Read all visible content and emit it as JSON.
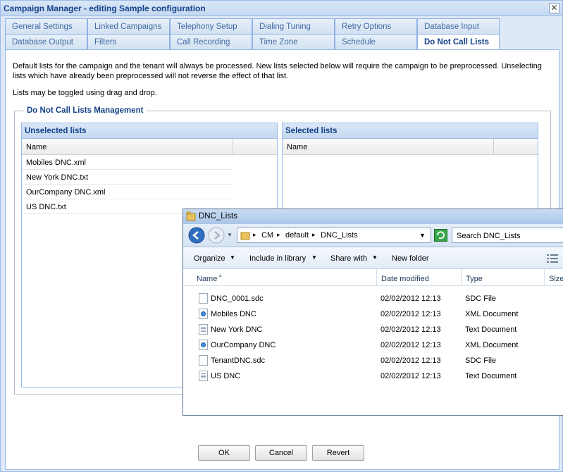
{
  "window": {
    "title": "Campaign Manager - editing Sample configuration",
    "close_glyph": "✕"
  },
  "tabs": {
    "row1": [
      "General Settings",
      "Linked Campaigns",
      "Telephony Setup",
      "Dialing Tuning",
      "Retry Options",
      "Database Input"
    ],
    "row2": [
      "Database Output",
      "Filters",
      "Call Recording",
      "Time Zone",
      "Schedule",
      "Do Not Call Lists"
    ],
    "active": "Do Not Call Lists"
  },
  "content": {
    "description": "Default lists for the campaign and the tenant will always be processed. New lists selected below will require the campaign to be preprocessed. Unselecting lists which have already been preprocessed will not reverse the effect of that list.",
    "toggle_hint": "Lists may be toggled using drag and drop.",
    "fieldset_legend": "Do Not Call Lists Management"
  },
  "unselected": {
    "title": "Unselected lists",
    "column": "Name",
    "items": [
      "Mobiles DNC.xml",
      "New York DNC.txt",
      "OurCompany DNC.xml",
      "US DNC.txt"
    ]
  },
  "selected": {
    "title": "Selected lists",
    "column": "Name",
    "items": []
  },
  "buttons": {
    "ok": "OK",
    "cancel": "Cancel",
    "revert": "Revert"
  },
  "explorer": {
    "title": "DNC_Lists",
    "breadcrumb": [
      "CM",
      "default",
      "DNC_Lists"
    ],
    "search_placeholder": "Search DNC_Lists",
    "toolbar": {
      "organize": "Organize",
      "include": "Include in library",
      "share": "Share with",
      "new_folder": "New folder"
    },
    "columns": {
      "name": "Name",
      "date": "Date modified",
      "type": "Type",
      "size": "Size"
    },
    "files": [
      {
        "name": "DNC_0001.sdc",
        "date": "02/02/2012 12:13",
        "type": "SDC File",
        "icon": "generic-file-icon"
      },
      {
        "name": "Mobiles DNC",
        "date": "02/02/2012 12:13",
        "type": "XML Document",
        "icon": "xml-file-icon"
      },
      {
        "name": "New York DNC",
        "date": "02/02/2012 12:13",
        "type": "Text Document",
        "icon": "text-file-icon"
      },
      {
        "name": "OurCompany DNC",
        "date": "02/02/2012 12:13",
        "type": "XML Document",
        "icon": "xml-file-icon"
      },
      {
        "name": "TenantDNC.sdc",
        "date": "02/02/2012 12:13",
        "type": "SDC File",
        "icon": "generic-file-icon"
      },
      {
        "name": "US DNC",
        "date": "02/02/2012 12:13",
        "type": "Text Document",
        "icon": "text-file-icon"
      }
    ]
  }
}
